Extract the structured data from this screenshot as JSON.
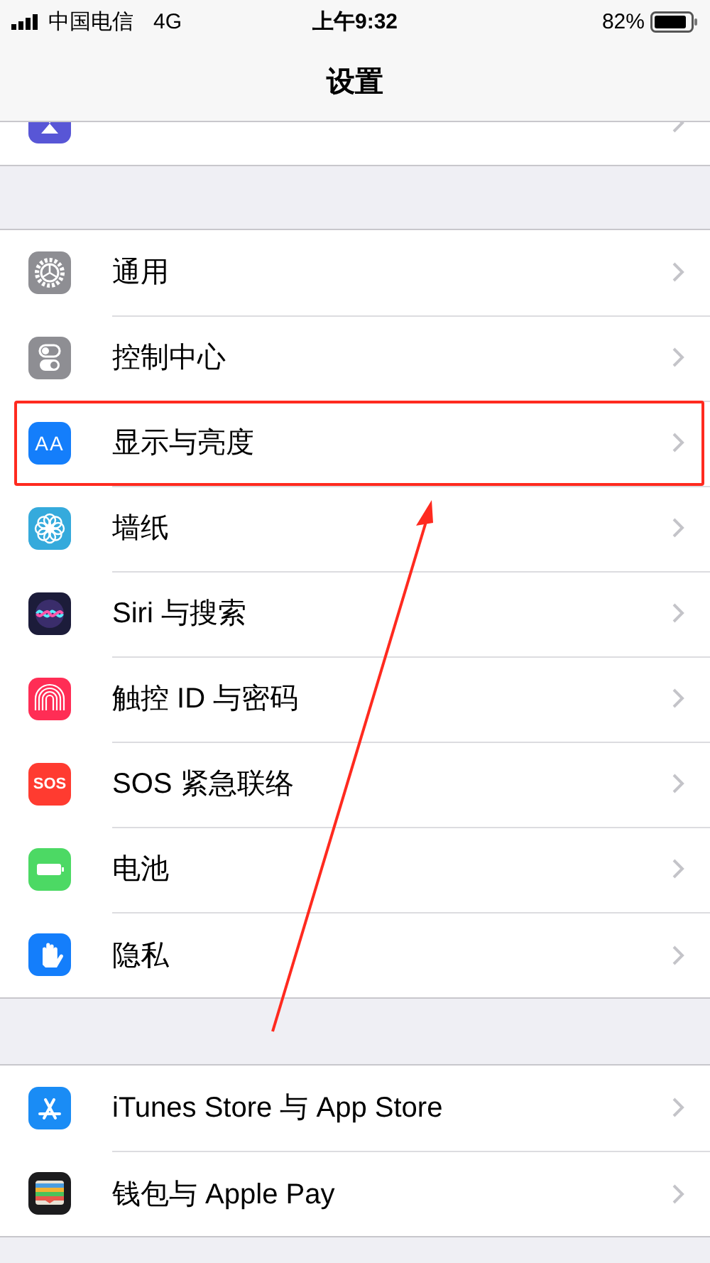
{
  "status_bar": {
    "carrier": "中国电信",
    "network": "4G",
    "time": "上午9:32",
    "battery": "82%"
  },
  "nav": {
    "title": "设置"
  },
  "groups": [
    {
      "items": [
        {
          "label": "通用",
          "boxed": false
        },
        {
          "label": "控制中心",
          "boxed": false
        },
        {
          "label": "显示与亮度",
          "boxed": true,
          "icon_text": "AA"
        },
        {
          "label": "墙纸",
          "boxed": false
        },
        {
          "label": "Siri 与搜索",
          "boxed": false
        },
        {
          "label": "触控 ID 与密码",
          "boxed": false
        },
        {
          "label": "SOS 紧急联络",
          "boxed": false,
          "icon_text": "SOS"
        },
        {
          "label": "电池",
          "boxed": false
        },
        {
          "label": "隐私",
          "boxed": false
        }
      ]
    },
    {
      "items": [
        {
          "label": "iTunes Store 与 App Store",
          "boxed": false
        },
        {
          "label": "钱包与 Apple Pay",
          "boxed": false
        }
      ]
    }
  ]
}
